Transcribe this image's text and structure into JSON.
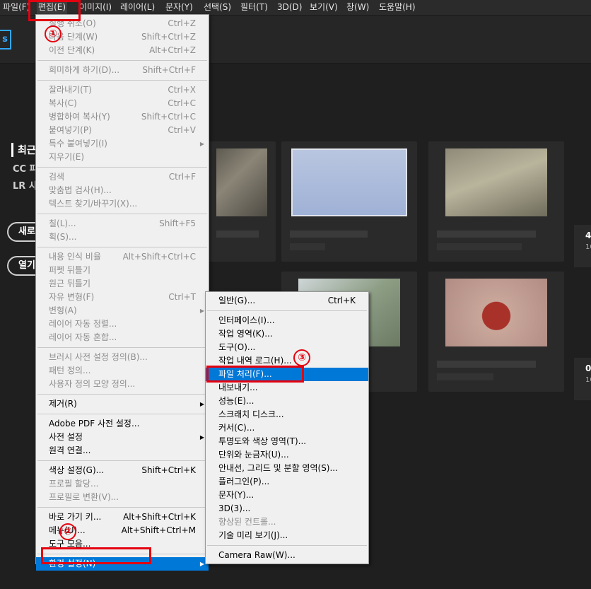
{
  "menubar": {
    "items": [
      "파일(F)",
      "편집(E)",
      "이미지(I)",
      "레이어(L)",
      "문자(Y)",
      "선택(S)",
      "필터(T)",
      "3D(D)",
      "보기(V)",
      "창(W)",
      "도움말(H)"
    ]
  },
  "app": {
    "logo": "s"
  },
  "home": {
    "recent_title": "최근",
    "links": [
      "CC 파",
      "LR 사"
    ],
    "buttons": [
      "새로",
      "열기"
    ],
    "right_texts": [
      "4",
      "10",
      "0",
      "10"
    ]
  },
  "edit_menu": {
    "items": [
      {
        "label": "실행 취소(O)",
        "shortcut": "Ctrl+Z",
        "disabled": true
      },
      {
        "label": "다음 단계(W)",
        "shortcut": "Shift+Ctrl+Z",
        "disabled": true
      },
      {
        "label": "이전 단계(K)",
        "shortcut": "Alt+Ctrl+Z",
        "disabled": true
      },
      {
        "label": "희미하게 하기(D)...",
        "shortcut": "Shift+Ctrl+F",
        "disabled": true
      },
      {
        "label": "잘라내기(T)",
        "shortcut": "Ctrl+X",
        "disabled": true
      },
      {
        "label": "복사(C)",
        "shortcut": "Ctrl+C",
        "disabled": true
      },
      {
        "label": "병합하여 복사(Y)",
        "shortcut": "Shift+Ctrl+C",
        "disabled": true
      },
      {
        "label": "붙여넣기(P)",
        "shortcut": "Ctrl+V",
        "disabled": true
      },
      {
        "label": "특수 붙여넣기(I)",
        "shortcut": "",
        "disabled": true,
        "submenu": true
      },
      {
        "label": "지우기(E)",
        "shortcut": "",
        "disabled": true
      },
      {
        "label": "검색",
        "shortcut": "Ctrl+F",
        "disabled": true
      },
      {
        "label": "맞춤법 검사(H)...",
        "shortcut": "",
        "disabled": true
      },
      {
        "label": "텍스트 찾기/바꾸기(X)...",
        "shortcut": "",
        "disabled": true
      },
      {
        "label": "칠(L)...",
        "shortcut": "Shift+F5",
        "disabled": true
      },
      {
        "label": "획(S)...",
        "shortcut": "",
        "disabled": true
      },
      {
        "label": "내용 인식 비율",
        "shortcut": "Alt+Shift+Ctrl+C",
        "disabled": true
      },
      {
        "label": "퍼펫 뒤틀기",
        "shortcut": "",
        "disabled": true
      },
      {
        "label": "원근 뒤틀기",
        "shortcut": "",
        "disabled": true
      },
      {
        "label": "자유 변형(F)",
        "shortcut": "Ctrl+T",
        "disabled": true
      },
      {
        "label": "변형(A)",
        "shortcut": "",
        "disabled": true,
        "submenu": true
      },
      {
        "label": "레이어 자동 정렬...",
        "shortcut": "",
        "disabled": true
      },
      {
        "label": "레이어 자동 혼합...",
        "shortcut": "",
        "disabled": true
      },
      {
        "label": "브러시 사전 설정 정의(B)...",
        "shortcut": "",
        "disabled": true
      },
      {
        "label": "패턴 정의...",
        "shortcut": "",
        "disabled": true
      },
      {
        "label": "사용자 정의 모양 정의...",
        "shortcut": "",
        "disabled": true
      },
      {
        "label": "제거(R)",
        "shortcut": "",
        "disabled": false,
        "submenu": true
      },
      {
        "label": "Adobe PDF 사전 설정...",
        "shortcut": "",
        "disabled": false
      },
      {
        "label": "사전 설정",
        "shortcut": "",
        "disabled": false,
        "submenu": true
      },
      {
        "label": "원격 연결...",
        "shortcut": "",
        "disabled": false
      },
      {
        "label": "색상 설정(G)...",
        "shortcut": "Shift+Ctrl+K",
        "disabled": false
      },
      {
        "label": "프로필 할당...",
        "shortcut": "",
        "disabled": true
      },
      {
        "label": "프로필로 변환(V)...",
        "shortcut": "",
        "disabled": true
      },
      {
        "label": "바로 가기 키...",
        "shortcut": "Alt+Shift+Ctrl+K",
        "disabled": false
      },
      {
        "label": "메뉴(U)...",
        "shortcut": "Alt+Shift+Ctrl+M",
        "disabled": false
      },
      {
        "label": "도구 모음...",
        "shortcut": "",
        "disabled": false
      },
      {
        "label": "환경 설정(N)",
        "shortcut": "",
        "disabled": false,
        "submenu": true,
        "highlighted": true
      }
    ]
  },
  "prefs_menu": {
    "items": [
      {
        "label": "일반(G)...",
        "shortcut": "Ctrl+K"
      },
      {
        "label": "인터페이스(I)...",
        "shortcut": ""
      },
      {
        "label": "작업 영역(K)...",
        "shortcut": ""
      },
      {
        "label": "도구(O)...",
        "shortcut": ""
      },
      {
        "label": "작업 내역 로그(H)...",
        "shortcut": ""
      },
      {
        "label": "파일 처리(F)...",
        "shortcut": "",
        "highlighted": true
      },
      {
        "label": "내보내기...",
        "shortcut": ""
      },
      {
        "label": "성능(E)...",
        "shortcut": ""
      },
      {
        "label": "스크래치 디스크...",
        "shortcut": ""
      },
      {
        "label": "커서(C)...",
        "shortcut": ""
      },
      {
        "label": "투명도와 색상 영역(T)...",
        "shortcut": ""
      },
      {
        "label": "단위와 눈금자(U)...",
        "shortcut": ""
      },
      {
        "label": "안내선, 그리드 및 분할 영역(S)...",
        "shortcut": ""
      },
      {
        "label": "플러그인(P)...",
        "shortcut": ""
      },
      {
        "label": "문자(Y)...",
        "shortcut": ""
      },
      {
        "label": "3D(3)...",
        "shortcut": ""
      },
      {
        "label": "향상된 컨트롤...",
        "shortcut": "",
        "disabled": true
      },
      {
        "label": "기술 미리 보기(J)...",
        "shortcut": ""
      },
      {
        "label": "Camera Raw(W)...",
        "shortcut": ""
      }
    ]
  },
  "annotations": [
    "①",
    "②",
    "③"
  ],
  "colors": {
    "accent": "#0078d7",
    "annotation": "#e3000f",
    "ps_blue": "#31a8ff"
  }
}
